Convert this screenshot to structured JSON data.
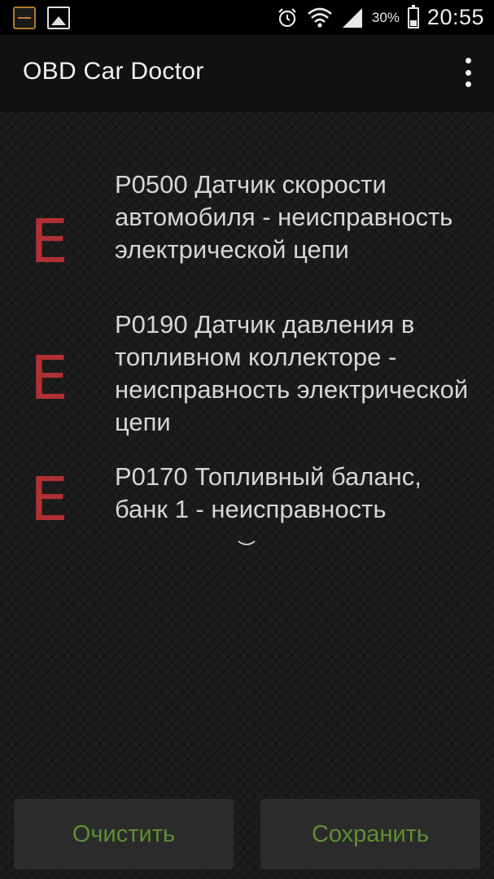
{
  "status_bar": {
    "battery_percent": "30%",
    "time": "20:55",
    "icons": [
      "car-doctor-notification-icon",
      "gallery-icon",
      "alarm-icon",
      "wifi-icon",
      "signal-icon",
      "battery-icon"
    ]
  },
  "action_bar": {
    "title": "OBD Car Doctor",
    "menu_icon": "overflow-menu-icon"
  },
  "errors": [
    {
      "badge": "E",
      "text": "P0500 Датчик скорости автомобиля - неисправность электрической цепи"
    },
    {
      "badge": "E",
      "text": "P0190 Датчик давления в топливном коллекторе - неисправность электрической цепи"
    },
    {
      "badge": "E",
      "text": "P0170 Топливный баланс, банк 1 - неисправность"
    }
  ],
  "buttons": {
    "clear_label": "Очистить",
    "save_label": "Сохранить"
  },
  "colors": {
    "error_badge": "#b03034",
    "button_text": "#5e8f33",
    "text": "#d6d6d6"
  }
}
